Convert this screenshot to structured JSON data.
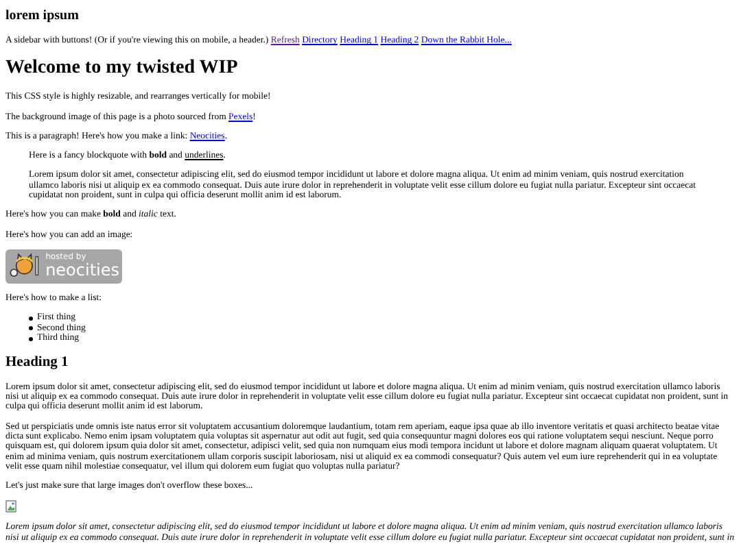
{
  "header": {
    "title": "lorem ipsum",
    "text": "A sidebar with buttons! (Or if you're viewing this on mobile, a header.)",
    "links": [
      {
        "label": "Refresh",
        "visited": true
      },
      {
        "label": "Directory",
        "visited": false
      },
      {
        "label": "Heading 1",
        "visited": false
      },
      {
        "label": "Heading 2",
        "visited": false
      },
      {
        "label": "Down the Rabbit Hole...",
        "visited": false
      }
    ]
  },
  "blocks": [
    {
      "kind": "heading1",
      "text": "Welcome to my twisted WIP"
    },
    {
      "kind": "paragraph",
      "text": "This CSS style is highly resizable, and rearranges vertically for mobile!"
    },
    {
      "kind": "paragraph",
      "text": "The background image of this page is a photo sourced from ",
      "link": "Pexels",
      "after": "!"
    },
    {
      "kind": "paragraph",
      "text": "This is a paragraph! Here's how you make a link: ",
      "link": "Neocities",
      "after": "."
    },
    {
      "kind": "blockquote",
      "paragraphs": [
        {
          "text": "Here is a fancy blockquote with **bold** and ",
          "underlined": "underlines",
          "after": "."
        },
        {
          "text": "Lorem ipsum dolor sit amet, consectetur adipiscing elit, sed do eiusmod tempor incididunt ut labore et dolore magna aliqua. Ut enim ad minim veniam, quis nostrud exercitation ullamco laboris nisi ut aliquip ex ea commodo consequat. Duis aute irure dolor in reprehenderit in voluptate velit esse cillum dolore eu fugiat nulla pariatur. Excepteur sint occaecat cupidatat non proident, sunt in culpa qui officia deserunt mollit anim id est laborum."
        }
      ]
    },
    {
      "kind": "paragraph",
      "text": "Here's how you can make **bold** and *italic* text."
    },
    {
      "kind": "paragraph",
      "text": "Here's how you can add an image:"
    },
    {
      "kind": "badge",
      "small": "hosted by",
      "big": "neocities"
    },
    {
      "kind": "paragraph",
      "text": "Here's how to make a list:"
    },
    {
      "kind": "list",
      "items": [
        "First thing",
        "Second thing",
        "Third thing"
      ]
    },
    {
      "kind": "heading2",
      "text": "Heading 1"
    },
    {
      "kind": "paragraph",
      "text": "Lorem ipsum dolor sit amet, consectetur adipiscing elit, sed do eiusmod tempor incididunt ut labore et dolore magna aliqua. Ut enim ad minim veniam, quis nostrud exercitation ullamco laboris nisi ut aliquip ex ea commodo consequat. Duis aute irure dolor in reprehenderit in voluptate velit esse cillum dolore eu fugiat nulla pariatur. Excepteur sint occaecat cupidatat non proident, sunt in culpa qui officia deserunt mollit anim id est laborum."
    },
    {
      "kind": "paragraph",
      "text": "Sed ut perspiciatis unde omnis iste natus error sit voluptatem accusantium doloremque laudantium, totam rem aperiam, eaque ipsa quae ab illo inventore veritatis et quasi architecto beatae vitae dicta sunt explicabo. Nemo enim ipsam voluptatem quia voluptas sit aspernatur aut odit aut fugit, sed quia consequuntur magni dolores eos qui ratione voluptatem sequi nesciunt. Neque porro quisquam est, qui dolorem ipsum quia dolor sit amet, consectetur, adipisci velit, sed quia non numquam eius modi tempora incidunt ut labore et dolore magnam aliquam quaerat voluptatem. Ut enim ad minima veniam, quis nostrum exercitationem ullam corporis suscipit laboriosam, nisi ut aliquid ex ea commodi consequatur? Quis autem vel eum iure reprehenderit qui in ea voluptate velit esse quam nihil molestiae consequatur, vel illum qui dolorem eum fugiat quo voluptas nulla pariatur?"
    },
    {
      "kind": "paragraph",
      "text": "Let's just make sure that large images don't overflow these boxes..."
    },
    {
      "kind": "broken_image"
    },
    {
      "kind": "italic_paragraph",
      "text": "Lorem ipsum dolor sit amet, consectetur adipiscing elit, sed do eiusmod tempor incididunt ut labore et dolore magna aliqua. Ut enim ad minim veniam, quis nostrud exercitation ullamco laboris nisi ut aliquip ex ea commodo consequat. Duis aute irure dolor in reprehenderit in voluptate velit esse cillum dolore eu fugiat nulla pariatur. Excepteur sint occaecat cupidatat non proident, sunt in"
    }
  ]
}
